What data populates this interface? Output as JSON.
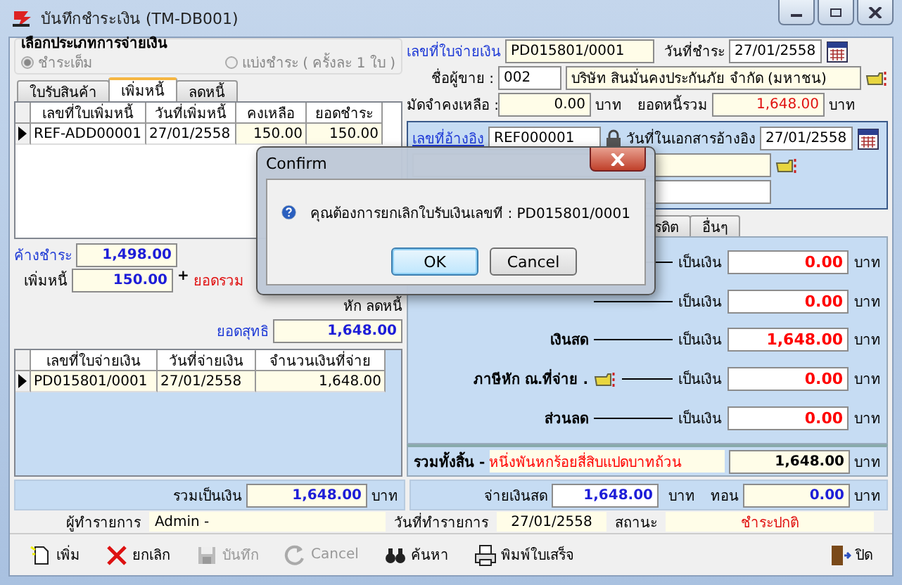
{
  "window": {
    "title": "บันทึกชำระเงิน (TM-DB001)"
  },
  "payment_type": {
    "title": "เลือกประเภทการจ่ายเงิน",
    "options": [
      {
        "label": "ชำระเต็ม",
        "selected": true
      },
      {
        "label": "แบ่งชำระ ( ครั้งละ 1 ใบ )",
        "selected": false
      }
    ]
  },
  "left_tabs": [
    {
      "label": "ใบรับสินค้า",
      "selected": false
    },
    {
      "label": "เพิ่มหนี้",
      "selected": true
    },
    {
      "label": "ลดหนี้",
      "selected": false
    }
  ],
  "debit_table": {
    "columns": [
      "เลขที่ใบเพิ่มหนี้",
      "วันที่เพิ่มหนี้",
      "คงเหลือ",
      "ยอดชำระ"
    ],
    "rows": [
      {
        "cells": [
          "REF-ADD00001",
          "27/01/2558",
          "150.00",
          "150.00"
        ],
        "selected": true
      }
    ]
  },
  "summary": {
    "outstanding": {
      "label": "ค้างชำระ",
      "value": "1,498.00"
    },
    "added_debt": {
      "label": "เพิ่มหนี้",
      "value": "150.00"
    },
    "plus": "+",
    "total_label": "ยอดรวม",
    "credit_label": "หัก ลดหนี้",
    "net": {
      "label": "ยอดสุทธิ",
      "value": "1,648.00"
    }
  },
  "payment_table": {
    "columns": [
      "เลขที่ใบจ่ายเงิน",
      "วันที่จ่ายเงิน",
      "จำนวนเงินที่จ่าย"
    ],
    "rows": [
      {
        "cells": [
          "PD015801/0001",
          "27/01/2558",
          "1,648.00"
        ],
        "selected": true
      }
    ]
  },
  "header": {
    "voucher": {
      "label": "เลขที่ใบจ่ายเงิน",
      "value": "PD015801/0001"
    },
    "pay_date": {
      "label": "วันที่ชำระ",
      "value": "27/01/2558"
    },
    "vendor": {
      "label": "ชื่อผู้ขาย :",
      "code": "002",
      "name": "บริษัท สินมั่นคงประกันภัย จำกัด (มหาชน)"
    },
    "deposit": {
      "label": "มัดจำคงเหลือ :",
      "value": "0.00",
      "unit": "บาท"
    },
    "total_debt": {
      "label": "ยอดหนี้รวม",
      "value": "1,648.00",
      "unit": "บาท"
    }
  },
  "reference": {
    "number": {
      "label": "เลขที่อ้างอิง",
      "value": "REF000001"
    },
    "date": {
      "label": "วันที่ในเอกสารอ้างอิง",
      "value": "27/01/2558"
    }
  },
  "method_tabs": [
    {
      "label": "รดิต",
      "selected": false
    },
    {
      "label": "อื่นๆ",
      "selected": false
    }
  ],
  "methods": [
    {
      "amount_label": "เป็นเงิน",
      "value": "0.00",
      "unit": "บาท"
    },
    {
      "amount_label": "เป็นเงิน",
      "value": "0.00",
      "unit": "บาท"
    },
    {
      "label": "เงินสด",
      "amount_label": "เป็นเงิน",
      "value": "1,648.00",
      "unit": "บาท",
      "lookup": false
    },
    {
      "label": "ภาษีหัก ณ.ที่จ่าย .",
      "amount_label": "เป็นเงิน",
      "value": "0.00",
      "unit": "บาท",
      "lookup": true
    },
    {
      "label": "ส่วนลด",
      "amount_label": "เป็นเงิน",
      "value": "0.00",
      "unit": "บาท",
      "lookup": false
    }
  ],
  "grand_total": {
    "label": "รวมทั้งสิ้น -",
    "words": "หนึ่งพันหกร้อยสี่สิบแปดบาทถ้วน",
    "value": "1,648.00",
    "unit": "บาท"
  },
  "totals": {
    "sum": {
      "label": "รวมเป็นเงิน",
      "value": "1,648.00",
      "unit": "บาท"
    },
    "cash": {
      "label": "จ่ายเงินสด",
      "value": "1,648.00",
      "unit": "บาท"
    },
    "change": {
      "label": "ทอน",
      "value": "0.00",
      "unit": "บาท"
    }
  },
  "info": {
    "user": {
      "label": "ผู้ทำรายการ",
      "value": "Admin -"
    },
    "date": {
      "label": "วันที่ทำรายการ",
      "value": "27/01/2558"
    },
    "status": {
      "label": "สถานะ",
      "value": "ชำระปกติ"
    }
  },
  "toolbar": [
    {
      "kind": "new",
      "label": "เพิ่ม",
      "disabled": false
    },
    {
      "kind": "delete",
      "label": "ยกเลิก",
      "disabled": false
    },
    {
      "kind": "save",
      "label": "บันทึก",
      "disabled": true
    },
    {
      "kind": "undo",
      "label": "Cancel",
      "disabled": true
    },
    {
      "kind": "search",
      "label": "ค้นหา",
      "disabled": false
    },
    {
      "kind": "print",
      "label": "พิมพ์ใบเสร็จ",
      "disabled": false
    },
    {
      "kind": "exit",
      "label": "ปิด",
      "disabled": false
    }
  ],
  "dialog": {
    "title": "Confirm",
    "message": "คุณต้องการยกเลิกใบรับเงินเลขที : PD015801/0001",
    "buttons": [
      {
        "label": "OK",
        "focused": true
      },
      {
        "label": "Cancel",
        "focused": false
      }
    ]
  }
}
